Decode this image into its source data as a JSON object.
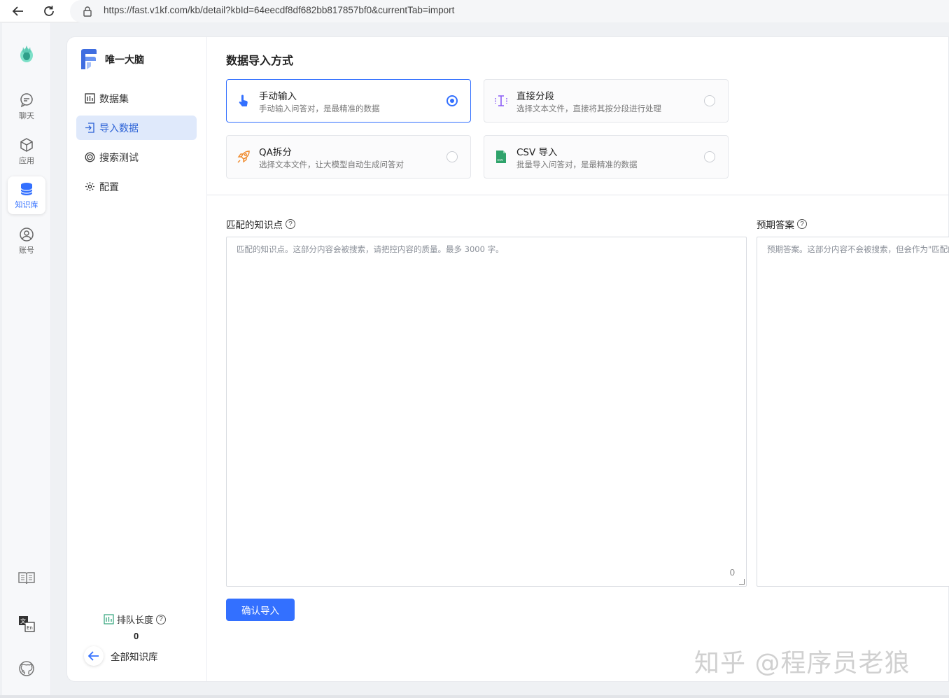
{
  "browser": {
    "url": "https://fast.v1kf.com/kb/detail?kbId=64eecdf8df682bb817857bf0&currentTab=import"
  },
  "rail": {
    "items": [
      {
        "label": "聊天",
        "icon": "chat-icon"
      },
      {
        "label": "应用",
        "icon": "cube-icon"
      },
      {
        "label": "知识库",
        "icon": "database-icon",
        "active": true
      },
      {
        "label": "账号",
        "icon": "user-icon"
      }
    ],
    "accent": "#3370ff"
  },
  "kb": {
    "name": "唯一大脑",
    "menu": [
      {
        "label": "数据集",
        "icon": "table-icon"
      },
      {
        "label": "导入数据",
        "icon": "import-icon",
        "active": true
      },
      {
        "label": "搜索测试",
        "icon": "target-icon"
      },
      {
        "label": "配置",
        "icon": "gear-icon"
      }
    ],
    "queue_label": "排队长度",
    "queue_value": "0",
    "back_label": "全部知识库"
  },
  "import": {
    "title": "数据导入方式",
    "options": [
      {
        "title": "手动输入",
        "desc": "手动输入问答对，是最精准的数据",
        "selected": true,
        "icon": "hand-pointer-icon"
      },
      {
        "title": "直接分段",
        "desc": "选择文本文件，直接将其按分段进行处理",
        "selected": false,
        "icon": "segment-icon"
      },
      {
        "title": "QA拆分",
        "desc": "选择文本文件，让大模型自动生成问答对",
        "selected": false,
        "icon": "rocket-icon"
      },
      {
        "title": "CSV 导入",
        "desc": "批量导入问答对，是最精准的数据",
        "selected": false,
        "icon": "csv-file-icon"
      }
    ],
    "q_label": "匹配的知识点",
    "q_placeholder": "匹配的知识点。这部分内容会被搜索，请把控内容的质量。最多 3000 字。",
    "q_count": "0",
    "a_label": "预期答案",
    "a_placeholder": "预期答案。这部分内容不会被搜索，但会作为\"匹配的知识点\"的内容补充",
    "confirm_label": "确认导入"
  },
  "watermark": "知乎 @程序员老狼"
}
